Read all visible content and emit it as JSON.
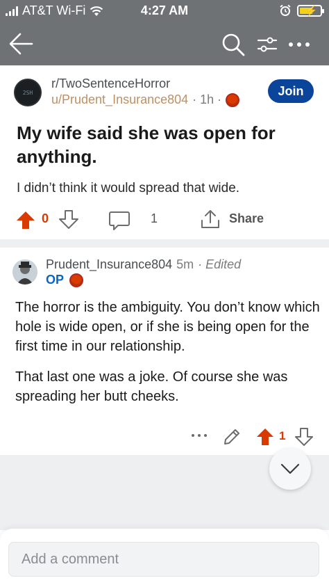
{
  "status_bar": {
    "carrier": "AT&T Wi-Fi",
    "time": "4:27 AM",
    "icons": [
      "signal-icon",
      "wifi-icon",
      "alarm-icon",
      "battery-charging-icon"
    ]
  },
  "header": {
    "icons": [
      "back-arrow-icon",
      "search-icon",
      "filter-icon",
      "more-icon"
    ]
  },
  "post": {
    "subreddit": "r/TwoSentenceHorror",
    "author": "u/Prudent_Insurance804",
    "meta": "· 1h ·",
    "join_label": "Join",
    "title": "My wife said she was open for anything.",
    "body": "I didn’t think it would spread that wide.",
    "vote_count": "0",
    "comment_count": "1",
    "share_label": "Share"
  },
  "comment": {
    "author": "Prudent_Insurance804",
    "time": "5m",
    "edited": "· Edited",
    "op_badge": "OP",
    "paragraphs": [
      "The horror is the ambiguity. You don’t know which hole is wide open, or if she is being open for the first time in our relationship.",
      "That last one was a joke. Of course she was spreading her butt cheeks."
    ],
    "vote_count": "1"
  },
  "composer": {
    "placeholder": "Add a comment"
  },
  "colors": {
    "header_bg": "#6f7275",
    "upvote": "#d93a00",
    "join_bg": "#0a449b",
    "op": "#0a66c2"
  }
}
